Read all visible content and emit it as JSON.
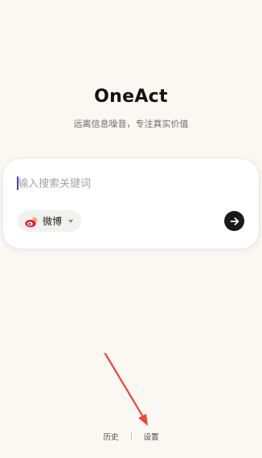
{
  "app": {
    "title": "OneAct",
    "tagline": "远离信息噪音，专注真实价值"
  },
  "search": {
    "placeholder": "输入搜索关键词",
    "value": "",
    "source": {
      "label": "微博",
      "icon": "weibo-icon"
    },
    "submit_icon": "arrow-right-icon"
  },
  "footer": {
    "history_label": "历史",
    "settings_label": "设置"
  },
  "colors": {
    "background": "#fbf8f4",
    "accent_dark": "#1a1a1a",
    "weibo_red": "#e6162d",
    "annotation_arrow": "#e8473c"
  }
}
